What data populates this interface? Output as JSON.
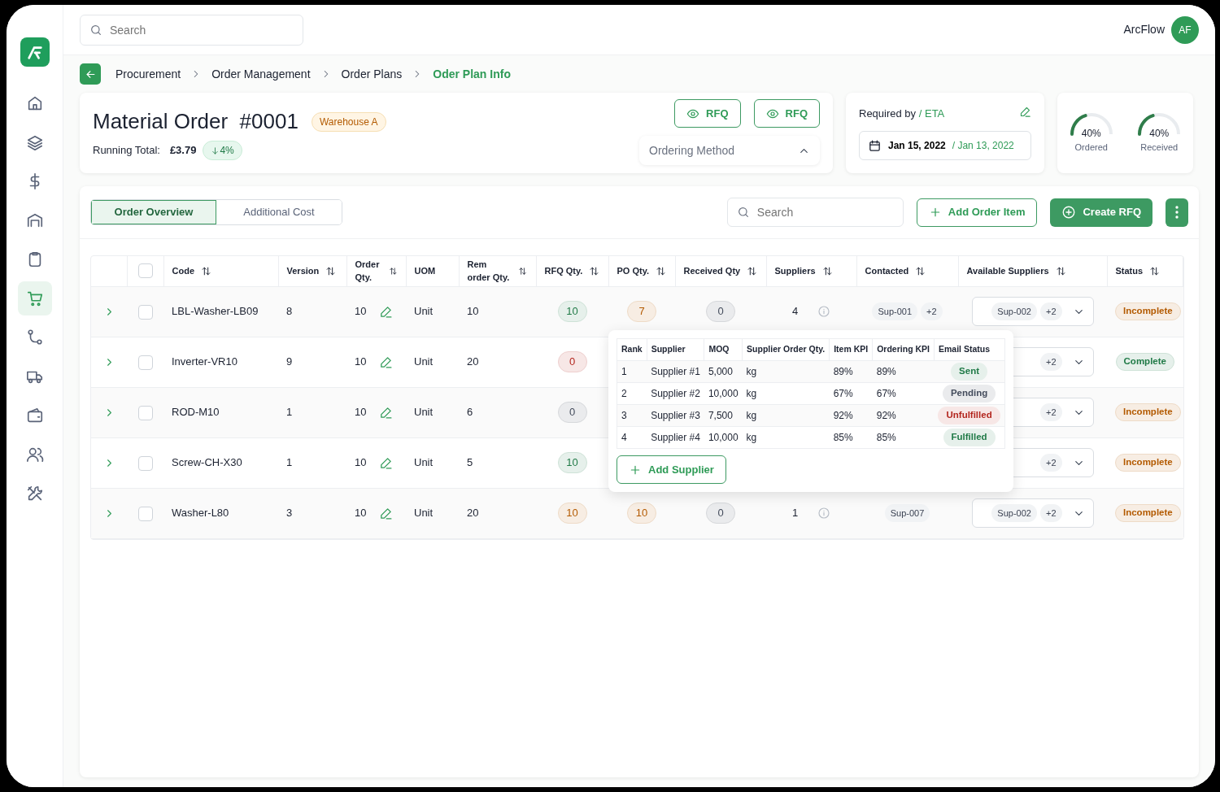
{
  "sidebar": {
    "items": [
      {
        "kind": "home",
        "selected": false
      },
      {
        "kind": "layers",
        "selected": false
      },
      {
        "kind": "dollar",
        "selected": false
      },
      {
        "kind": "warehouse",
        "selected": false
      },
      {
        "kind": "clipboard",
        "selected": false
      },
      {
        "kind": "cart",
        "selected": true
      },
      {
        "kind": "route",
        "selected": false
      },
      {
        "kind": "truck",
        "selected": false
      },
      {
        "kind": "wallet",
        "selected": false
      },
      {
        "kind": "users",
        "selected": false
      },
      {
        "kind": "tools",
        "selected": false
      }
    ]
  },
  "topbar": {
    "search": {
      "placeholder": "Search"
    },
    "user": {
      "name": "ArcFlow",
      "initials": "AF"
    }
  },
  "breadcrumb": [
    {
      "label": "Procurement",
      "current": false
    },
    {
      "label": "Order Management",
      "current": false
    },
    {
      "label": "Order Plans",
      "current": false
    },
    {
      "label": "Oder Plan Info",
      "current": true
    }
  ],
  "order": {
    "title": "Material Order",
    "number": "#0001",
    "location": "Warehouse A",
    "running_total_label": "Running Total:",
    "running_total": "£3.79",
    "change": "4%",
    "buttons": [
      "RFQ",
      "RFQ"
    ],
    "ordering_method": {
      "placeholder": "Ordering Method"
    }
  },
  "dates": {
    "label": "Required by",
    "label_eta": "/ ETA",
    "required": "Jan 15, 2022",
    "eta": "/ Jan 13, 2022"
  },
  "gauges": [
    {
      "reading": "40%",
      "label": "Ordered",
      "level": 0.4
    },
    {
      "reading": "40%",
      "label": "Received",
      "level": 0.4
    }
  ],
  "tabs": [
    {
      "label": "Order Overview",
      "selected": true
    },
    {
      "label": "Additional Cost",
      "selected": false
    }
  ],
  "toolbar": {
    "search": {
      "placeholder": "Search"
    },
    "add_button": "Add Order Item",
    "create_button": "Create RFQ"
  },
  "table": {
    "columns": [
      "Code",
      "Version",
      "Order Qty.",
      "UOM",
      "Rem order Qty.",
      "RFQ Qty.",
      "PO Qty.",
      "Received Qty",
      "Suppliers",
      "Contacted",
      "Available Suppliers",
      "Status"
    ],
    "sortable": [
      true,
      true,
      true,
      false,
      true,
      true,
      true,
      true,
      true,
      true,
      true,
      true
    ],
    "select_all_checked": false,
    "rows": [
      {
        "checked": false,
        "code": "LBL-Washer-LB09",
        "version": "8",
        "order_qty": "10",
        "uom": "Unit",
        "rem_qty": "10",
        "rfq_qty": {
          "value": "10",
          "color": "#207a47"
        },
        "po_qty": {
          "value": "7",
          "color": "#b35a00"
        },
        "received": "0",
        "suppliers": "4",
        "contacted": [
          "Sup-001",
          "+2"
        ],
        "available": [
          "Sup-002",
          "+2"
        ],
        "status": {
          "label": "Incomplete",
          "color": "#b35a00"
        }
      },
      {
        "checked": false,
        "code": "Inverter-VR10",
        "version": "9",
        "order_qty": "10",
        "uom": "Unit",
        "rem_qty": "20",
        "rfq_qty": {
          "value": "0",
          "color": "#b3261e"
        },
        "available": [
          "+2"
        ],
        "status": {
          "label": "Complete",
          "color": "#207a47"
        }
      },
      {
        "checked": false,
        "code": "ROD-M10",
        "version": "1",
        "order_qty": "10",
        "uom": "Unit",
        "rem_qty": "6",
        "rfq_qty": {
          "value": "0",
          "color": "#444c5c"
        },
        "available": [
          "+2"
        ],
        "status": {
          "label": "Incomplete",
          "color": "#b35a00"
        }
      },
      {
        "checked": false,
        "code": "Screw-CH-X30",
        "version": "1",
        "order_qty": "10",
        "uom": "Unit",
        "rem_qty": "5",
        "rfq_qty": {
          "value": "10",
          "color": "#207a47"
        },
        "available": [
          "+2"
        ],
        "status": {
          "label": "Incomplete",
          "color": "#b35a00"
        }
      },
      {
        "checked": false,
        "code": "Washer-L80",
        "version": "3",
        "order_qty": "10",
        "uom": "Unit",
        "rem_qty": "20",
        "rfq_qty": {
          "value": "10",
          "color": "#b35a00"
        },
        "po_qty": {
          "value": "10",
          "color": "#b35a00"
        },
        "received": "0",
        "suppliers": "1",
        "contacted": [
          "Sup-007"
        ],
        "available": [
          "Sup-002",
          "+2"
        ],
        "status": {
          "label": "Incomplete",
          "color": "#b35a00"
        }
      }
    ]
  },
  "supplier_popover": {
    "columns": [
      "Rank",
      "Supplier",
      "MOQ",
      "Supplier Order Qty.",
      "Item KPI",
      "Ordering KPI",
      "Email Status"
    ],
    "rows": [
      {
        "rank": "1",
        "supplier": "Supplier #1",
        "moq": "5,000",
        "order_qty": "kg",
        "item_kpi": "89%",
        "ordering_kpi": "89%",
        "email_status": {
          "label": "Sent",
          "color": "#207a47"
        }
      },
      {
        "rank": "2",
        "supplier": "Supplier #2",
        "moq": "10,000",
        "order_qty": "kg",
        "item_kpi": "67%",
        "ordering_kpi": "67%",
        "email_status": {
          "label": "Pending",
          "color": "#444c5c"
        }
      },
      {
        "rank": "3",
        "supplier": "Supplier #3",
        "moq": "7,500",
        "order_qty": "kg",
        "item_kpi": "92%",
        "ordering_kpi": "92%",
        "email_status": {
          "label": "Unfulfilled",
          "color": "#b3261e"
        }
      },
      {
        "rank": "4",
        "supplier": "Supplier #4",
        "moq": "10,000",
        "order_qty": "kg",
        "item_kpi": "85%",
        "ordering_kpi": "85%",
        "email_status": {
          "label": "Fulfilled",
          "color": "#207a47"
        }
      }
    ],
    "add_button": "Add Supplier"
  }
}
